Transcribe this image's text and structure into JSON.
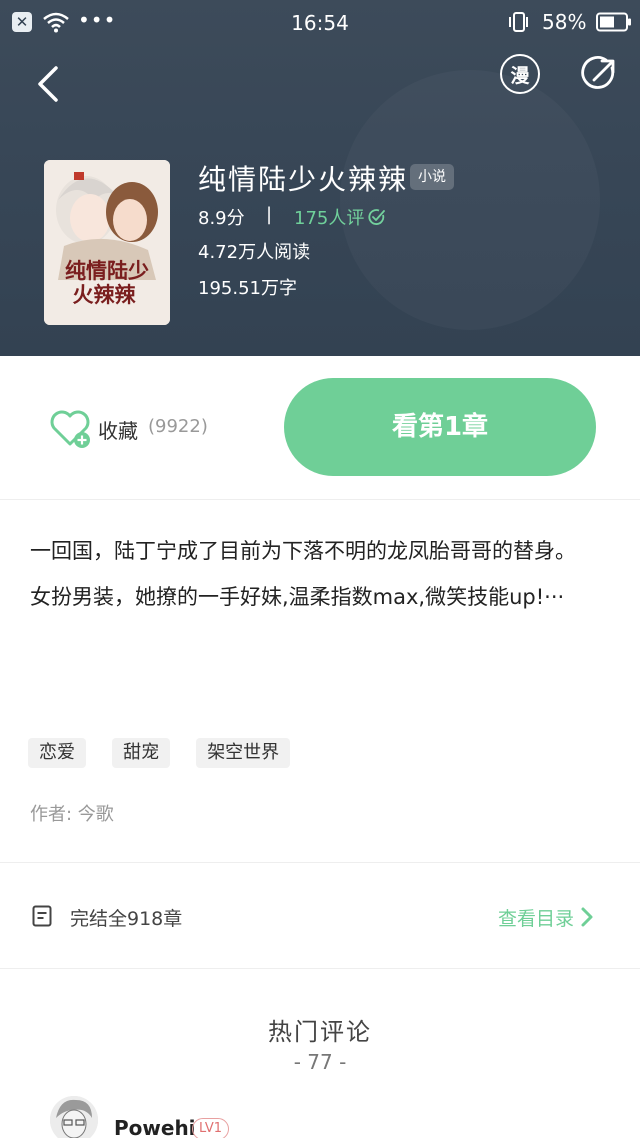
{
  "status_bar": {
    "time": "16:54",
    "battery_percent": "58%",
    "dots": "•••"
  },
  "nav": {
    "manga_glyph": "漫"
  },
  "book": {
    "title": "纯情陆少火辣辣",
    "type_badge": "小说",
    "rating": "8.9分",
    "separator": "|",
    "reviews": "175人评",
    "reads": "4.72万人阅读",
    "words": "195.51万字",
    "cover_text": "纯情陆少火辣辣"
  },
  "actions": {
    "favorite_label": "收藏",
    "favorite_count": "(9922)",
    "read_button": "看第1章"
  },
  "description": {
    "line1": "一回国，陆丁宁成了目前为下落不明的龙凤胎哥哥的替身。",
    "line2": "女扮男装，她撩的一手好妹,温柔指数max,微笑技能up!···"
  },
  "tags": [
    "恋爱",
    "甜宠",
    "架空世界"
  ],
  "author": "作者: 今歌",
  "chapters": {
    "status": "完结全918章",
    "toc_link": "查看目录"
  },
  "hot_comments": {
    "title": "热门评论",
    "count": "- 77 -",
    "first_user": "Powehi",
    "first_user_level": "LV1"
  },
  "colors": {
    "header_bg": "#384757",
    "accent_green": "#6fcf97",
    "review_green": "#6fd09a",
    "level_badge": "#e07070"
  },
  "icons": {
    "back": "chevron-left-icon",
    "manga": "manga-switch-icon",
    "share": "share-icon",
    "favorite": "heart-plus-icon",
    "review": "check-edit-icon",
    "doc": "document-icon",
    "toc_arrow": "chevron-right-icon"
  }
}
